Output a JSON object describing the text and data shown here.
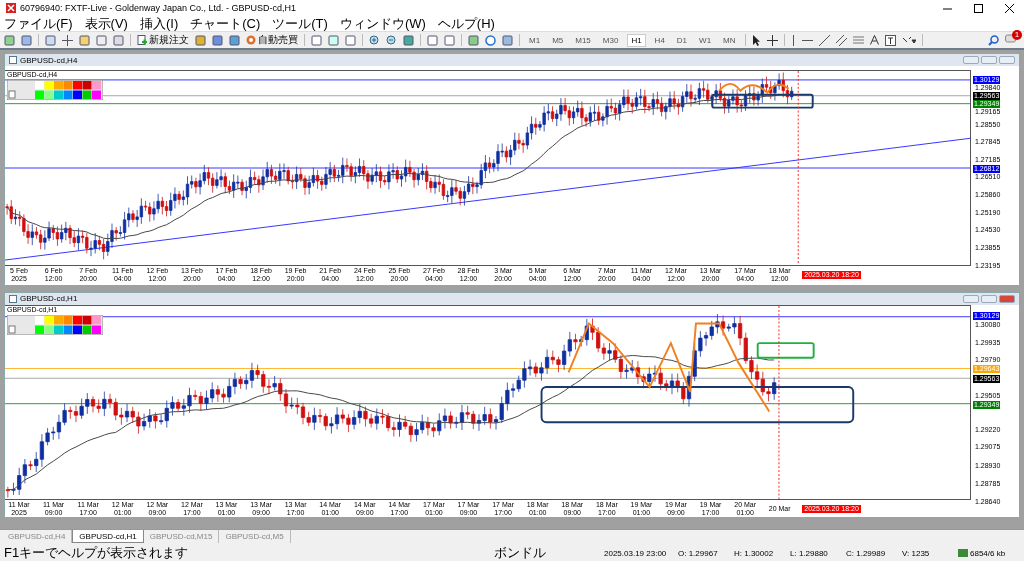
{
  "window": {
    "title": "60796940: FXTF-Live - Goldenway Japan Co., Ltd. - GBPUSD-cd,H1"
  },
  "menu": [
    "ファイル(F)",
    "表示(V)",
    "挿入(I)",
    "チャート(C)",
    "ツール(T)",
    "ウィンドウ(W)",
    "ヘルプ(H)"
  ],
  "toolbar": {
    "order_button": "新規注文",
    "auto_trading_button": "自動売買",
    "timeframes": [
      {
        "label": "M1",
        "selected": false
      },
      {
        "label": "M5",
        "selected": false
      },
      {
        "label": "M15",
        "selected": false
      },
      {
        "label": "M30",
        "selected": false
      },
      {
        "label": "H1",
        "selected": true
      },
      {
        "label": "H4",
        "selected": false
      },
      {
        "label": "D1",
        "selected": false
      },
      {
        "label": "W1",
        "selected": false
      },
      {
        "label": "MN",
        "selected": false
      }
    ],
    "notification_count": "1"
  },
  "charts": [
    {
      "title": "GBPUSD-cd,H4",
      "label": "GBPUSD-cd,H4",
      "active": false,
      "y_axis": [
        {
          "text": "1.30129",
          "kind": "badge",
          "color": "#0000ff"
        },
        {
          "text": "1.29840",
          "kind": "tick"
        },
        {
          "text": "1.29563",
          "kind": "badge",
          "color": "#000000"
        },
        {
          "text": "1.29349",
          "kind": "badge",
          "color": "#008000"
        },
        {
          "text": "1.29165",
          "kind": "tick"
        },
        {
          "text": "1.28550",
          "kind": "tick"
        },
        {
          "text": "1.27845",
          "kind": "tick"
        },
        {
          "text": "1.27185",
          "kind": "tick"
        },
        {
          "text": "1.26812",
          "kind": "badge",
          "color": "#0000ff"
        },
        {
          "text": "1.26510",
          "kind": "tick"
        },
        {
          "text": "1.25860",
          "kind": "tick"
        },
        {
          "text": "1.25190",
          "kind": "tick"
        },
        {
          "text": "1.24530",
          "kind": "tick"
        },
        {
          "text": "1.23855",
          "kind": "tick"
        },
        {
          "text": "1.23195",
          "kind": "tick"
        }
      ],
      "x_axis": [
        "5 Feb 2025",
        "6 Feb 12:00",
        "7 Feb 20:00",
        "11 Feb 04:00",
        "12 Feb 12:00",
        "13 Feb 20:00",
        "17 Feb 04:00",
        "18 Feb 12:00",
        "19 Feb 20:00",
        "21 Feb 04:00",
        "24 Feb 12:00",
        "25 Feb 20:00",
        "27 Feb 04:00",
        "28 Feb 12:00",
        "3 Mar 20:00",
        "5 Mar 04:00",
        "6 Mar 12:00",
        "7 Mar 20:00",
        "11 Mar 04:00",
        "12 Mar 12:00",
        "13 Mar 20:00",
        "17 Mar 04:00",
        "18 Mar 12:00"
      ],
      "time_highlight": "2025.03.20 18:20"
    },
    {
      "title": "GBPUSD-cd,H1",
      "label": "GBPUSD-cd,H1",
      "active": true,
      "y_axis": [
        {
          "text": "1.30129",
          "kind": "badge",
          "color": "#0000ff"
        },
        {
          "text": "1.30080",
          "kind": "tick"
        },
        {
          "text": "1.29935",
          "kind": "tick"
        },
        {
          "text": "1.29790",
          "kind": "tick"
        },
        {
          "text": "1.29643",
          "kind": "badge",
          "color": "#ffa500"
        },
        {
          "text": "1.29563",
          "kind": "badge",
          "color": "#000000"
        },
        {
          "text": "1.29505",
          "kind": "tick"
        },
        {
          "text": "1.29349",
          "kind": "badge",
          "color": "#008000"
        },
        {
          "text": "1.29220",
          "kind": "tick"
        },
        {
          "text": "1.29075",
          "kind": "tick"
        },
        {
          "text": "1.28930",
          "kind": "tick"
        },
        {
          "text": "1.28785",
          "kind": "tick"
        },
        {
          "text": "1.28640",
          "kind": "tick"
        }
      ],
      "x_axis": [
        "11 Mar 2025",
        "11 Mar 09:00",
        "11 Mar 17:00",
        "12 Mar 01:00",
        "12 Mar 09:00",
        "12 Mar 17:00",
        "13 Mar 01:00",
        "13 Mar 09:00",
        "13 Mar 17:00",
        "14 Mar 01:00",
        "14 Mar 09:00",
        "14 Mar 17:00",
        "17 Mar 01:00",
        "17 Mar 09:00",
        "17 Mar 17:00",
        "18 Mar 01:00",
        "18 Mar 09:00",
        "18 Mar 17:00",
        "19 Mar 01:00",
        "19 Mar 09:00",
        "19 Mar 17:00",
        "20 Mar 01:00",
        "20 Mar"
      ],
      "time_highlight": "2025.03.20 18:20"
    }
  ],
  "tabs": [
    {
      "label": "GBPUSD-cd,H4",
      "selected": false
    },
    {
      "label": "GBPUSD-cd,H1",
      "selected": true
    },
    {
      "label": "GBPUSD-cd,M15",
      "selected": false
    },
    {
      "label": "GBPUSD-cd,M5",
      "selected": false
    }
  ],
  "status_bar": {
    "help": "F1キーでヘルプが表示されます",
    "profile": "ボンドル",
    "time": "2025.03.19 23:00",
    "open": "O: 1.29967",
    "high": "H: 1.30002",
    "low": "L: 1.29880",
    "close": "C: 1.29989",
    "volume": "V: 1235",
    "traffic": "6854/6 kb"
  }
}
